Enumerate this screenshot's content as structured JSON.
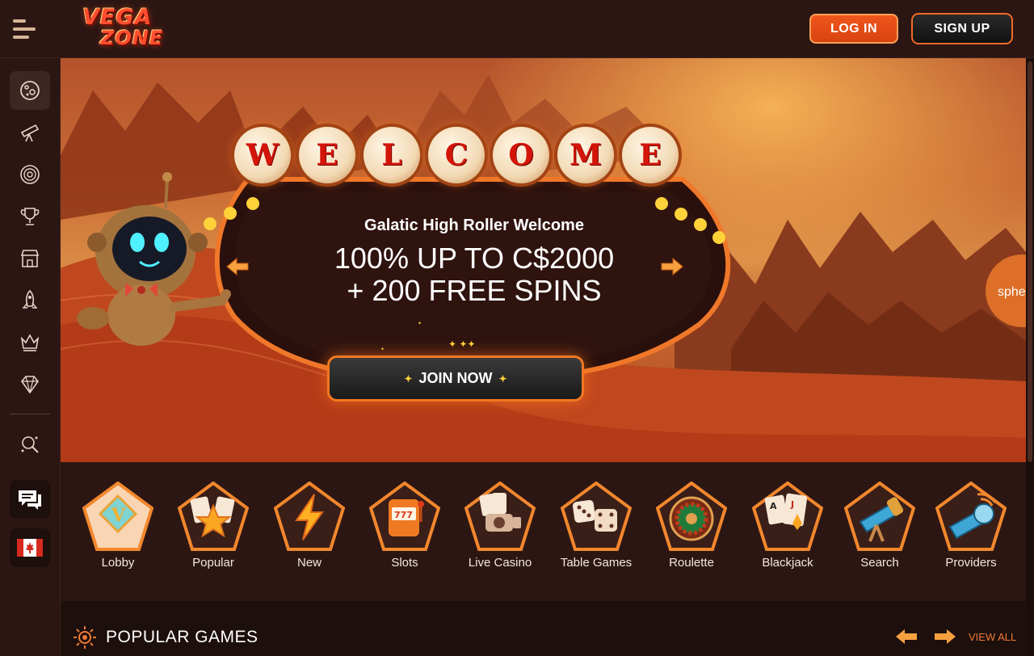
{
  "header": {
    "logo_line1": "VEGA",
    "logo_line2": "ZONE",
    "login_label": "LOG IN",
    "signup_label": "SIGN UP"
  },
  "banner": {
    "welcome_letters": [
      "W",
      "E",
      "L",
      "C",
      "O",
      "M",
      "E"
    ],
    "subtitle": "Galatic High Roller Welcome",
    "headline_line1": "100% UP TO C$2000",
    "headline_line2": "+ 200 FREE SPINS",
    "cta_label": "JOIN NOW",
    "side_badge": "sphe"
  },
  "categories": [
    "Lobby",
    "Popular",
    "New",
    "Slots",
    "Live Casino",
    "Table Games",
    "Roulette",
    "Blackjack",
    "Search",
    "Providers"
  ],
  "popular": {
    "title": "POPULAR GAMES",
    "view_all": "VIEW ALL"
  },
  "colors": {
    "accent": "#f0561d",
    "header_bg": "#2c1613",
    "page_bg": "#1d0f0c"
  }
}
